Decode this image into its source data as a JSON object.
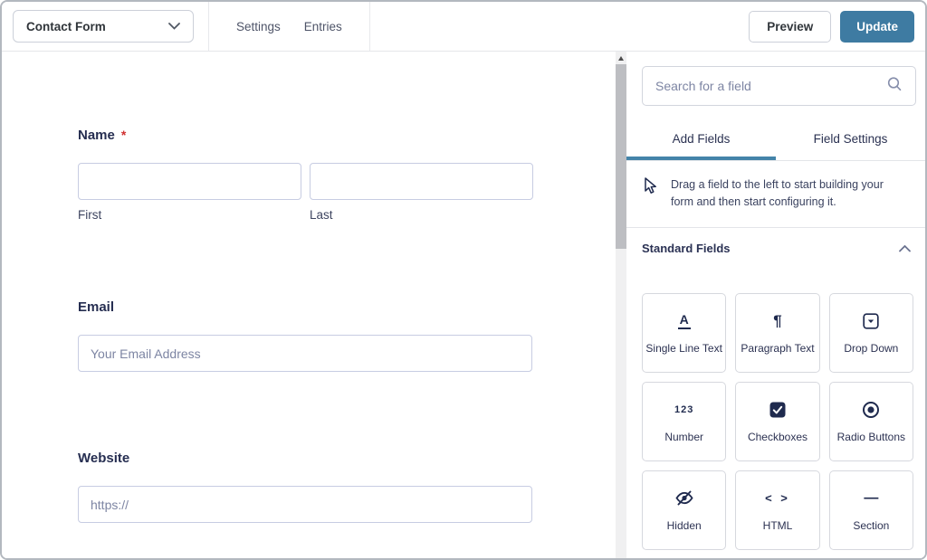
{
  "topbar": {
    "form_switcher": {
      "value": "Contact Form"
    },
    "nav": [
      {
        "label": "Settings"
      },
      {
        "label": "Entries"
      }
    ],
    "preview_label": "Preview",
    "update_label": "Update"
  },
  "canvas": {
    "fields": [
      {
        "label": "Name",
        "required_marker": "*",
        "sublabels": [
          "First",
          "Last"
        ]
      },
      {
        "label": "Email",
        "placeholder": "Your Email Address"
      },
      {
        "label": "Website",
        "placeholder": "https://"
      }
    ]
  },
  "sidebar": {
    "search": {
      "placeholder": "Search for a field",
      "icon": "search-icon"
    },
    "tabs": [
      {
        "label": "Add Fields",
        "active": true
      },
      {
        "label": "Field Settings",
        "active": false
      }
    ],
    "hint": {
      "icon": "cursor-arrow-icon",
      "text": "Drag a field to the left to start building your form and then start configuring it."
    },
    "section": {
      "title": "Standard Fields",
      "state_icon": "chevron-up-icon"
    },
    "field_buttons": [
      {
        "label": "Single Line Text",
        "icon": "single-line-text-icon",
        "glyph": "A"
      },
      {
        "label": "Paragraph Text",
        "icon": "paragraph-text-icon",
        "glyph": "¶"
      },
      {
        "label": "Drop Down",
        "icon": "drop-down-icon"
      },
      {
        "label": "Number",
        "icon": "number-icon",
        "glyph": "123"
      },
      {
        "label": "Checkboxes",
        "icon": "checkboxes-icon"
      },
      {
        "label": "Radio Buttons",
        "icon": "radio-buttons-icon"
      },
      {
        "label": "Hidden",
        "icon": "hidden-icon"
      },
      {
        "label": "HTML",
        "icon": "html-icon",
        "glyph": "< >"
      },
      {
        "label": "Section",
        "icon": "section-icon",
        "glyph": "—"
      }
    ]
  },
  "colors": {
    "accent": "#3e7ba2",
    "tab_underline": "#4484a9",
    "required_red": "#d03030",
    "label_navy": "#262e51",
    "input_border": "#c7cce2"
  }
}
